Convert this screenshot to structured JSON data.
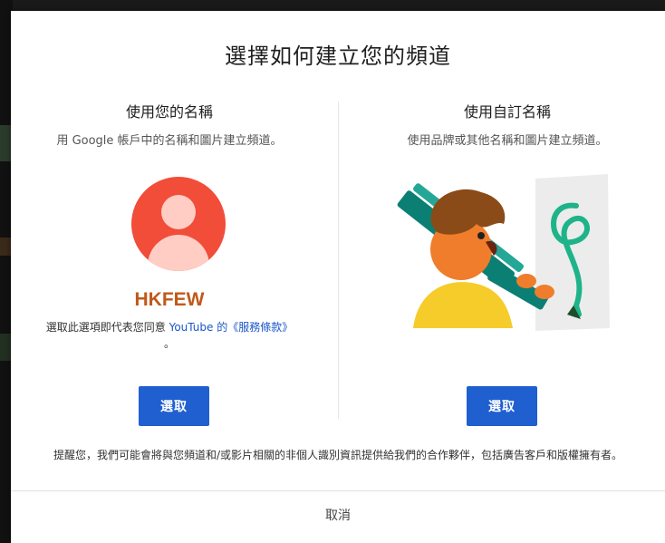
{
  "dialog": {
    "title": "選擇如何建立您的頻道",
    "left_option": {
      "title": "使用您的名稱",
      "description": "用 Google 帳戶中的名稱和圖片建立頻道。",
      "channel_name": "HKFEW",
      "terms_prefix": "選取此選項即代表您同意 ",
      "terms_link": "YouTube 的《服務條款》",
      "terms_suffix": "。",
      "button_label": "選取"
    },
    "right_option": {
      "title": "使用自訂名稱",
      "description": "使用品牌或其他名稱和圖片建立頻道。",
      "button_label": "選取"
    },
    "notice": "提醒您，我們可能會將與您頻道和/或影片相關的非個人識別資訊提供給我們的合作夥伴，包括廣告客戶和版權擁有者。",
    "cancel_label": "取消"
  },
  "colors": {
    "accent_button": "#1f5fd0",
    "avatar_bg": "#f14d39",
    "channel_name": "#c0591a",
    "link": "#1a56c9"
  }
}
